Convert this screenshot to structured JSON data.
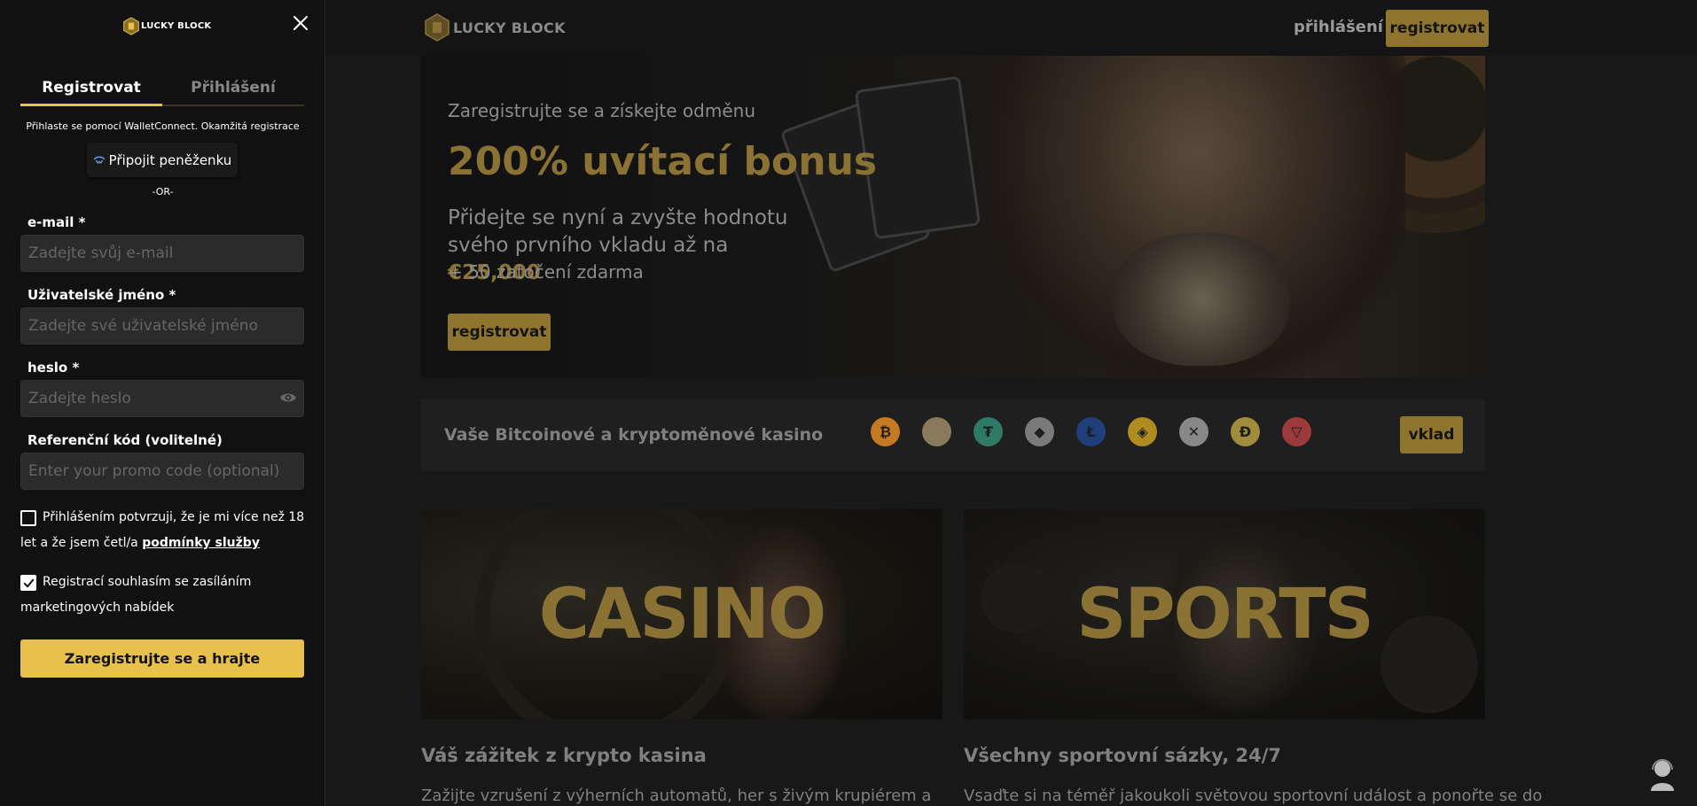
{
  "brand": {
    "name": "LUCKY BLOCK",
    "accent": "#e8c04d",
    "accent_dim": "#8f742e"
  },
  "header": {
    "login_label": "přihlášení",
    "register_label": "registrovat"
  },
  "hero": {
    "subtitle": "Zaregistrujte se a získejte odměnu",
    "title": "200% uvítací bonus",
    "text_part1": "Přidejte se nyní a zvyšte hodnotu svého prvního vkladu až na",
    "amount": "€25,000",
    "spins": "+ 50 zatočení zdarma",
    "button_label": "registrovat"
  },
  "crypto": {
    "title": "Vaše Bitcoinové a kryptoměnové kasino",
    "coins": [
      {
        "icon": "bitcoin-icon",
        "symbol": "₿",
        "color": "#c47a22"
      },
      {
        "icon": "luckyblock-coin-icon",
        "symbol": "",
        "color": "#8a7a5c"
      },
      {
        "icon": "tether-icon",
        "symbol": "₮",
        "color": "#2f7a66"
      },
      {
        "icon": "ethereum-icon",
        "symbol": "◆",
        "color": "#7a7a7a"
      },
      {
        "icon": "litecoin-icon",
        "symbol": "Ł",
        "color": "#1f3f7a"
      },
      {
        "icon": "bnb-icon",
        "symbol": "◈",
        "color": "#b08b22"
      },
      {
        "icon": "xrp-icon",
        "symbol": "✕",
        "color": "#888888"
      },
      {
        "icon": "dogecoin-icon",
        "symbol": "Ð",
        "color": "#a08c3a"
      },
      {
        "icon": "tron-icon",
        "symbol": "▽",
        "color": "#9a3a3a"
      }
    ],
    "button_label": "vklad"
  },
  "tiles": {
    "casino": "CASINO",
    "sports": "SPORTS"
  },
  "sections": {
    "casino_title": "Váš zážitek z krypto kasina",
    "casino_text": "Zažijte vzrušení z výherních automatů, her s živým krupiérem a",
    "sports_title": "Všechny sportovní sázky, 24/7",
    "sports_text": "Vsaďte si na téměř jakoukoli světovou sportovní událost a ponořte se do"
  },
  "panel": {
    "tab_register": "Registrovat",
    "tab_login": "Přihlášení",
    "walletconnect_note": "Přihlaste se pomocí WalletConnect. Okamžitá registrace",
    "wallet_button": "Připojit peněženku",
    "or": "-OR-",
    "email_label": "e-mail *",
    "email_placeholder": "Zadejte svůj e-mail",
    "username_label": "Uživatelské jméno *",
    "username_placeholder": "Zadejte své uživatelské jméno",
    "password_label": "heslo *",
    "password_placeholder": "Zadejte heslo",
    "referral_label": "Referenční kód (volitelné)",
    "referral_placeholder": "Enter your promo code (optional)",
    "terms_text": "Přihlášením potvrzuji, že je mi více než 18 let a že jsem četl/a",
    "terms_link": "podmínky služby",
    "terms_checked": false,
    "marketing_text": "Registrací souhlasím se zasíláním marketingových nabídek",
    "marketing_checked": true,
    "submit_label": "Zaregistrujte se a hrajte"
  }
}
